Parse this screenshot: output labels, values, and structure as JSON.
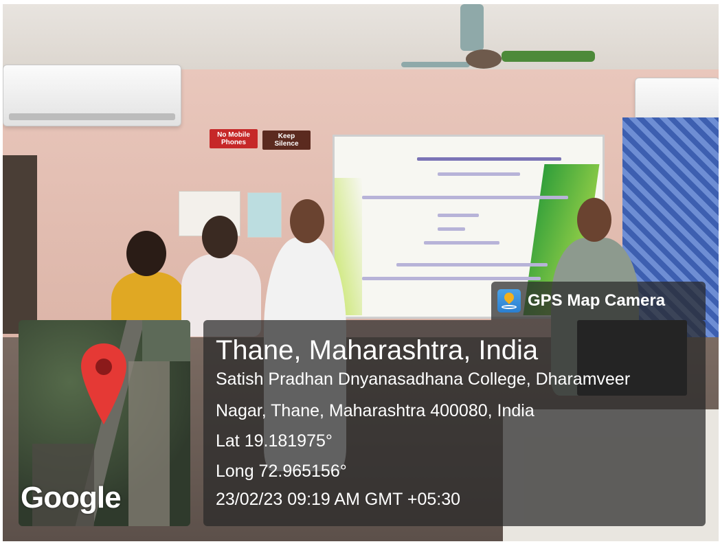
{
  "wall_signs": {
    "no_mobile": "No Mobile Phones",
    "keep_silence": "Keep Silence"
  },
  "app_badge": {
    "icon": "map-pin-icon",
    "title": "GPS Map Camera"
  },
  "location": {
    "city": "Thane, Maharashtra, India",
    "address_line1": "Satish Pradhan Dnyanasadhana College, Dharamveer",
    "address_line2": "Nagar, Thane, Maharashtra 400080, India",
    "latitude": "Lat 19.181975°",
    "longitude": "Long 72.965156°",
    "timestamp": "23/02/23 09:19 AM GMT +05:30"
  },
  "map": {
    "watermark": "Google",
    "marker_icon": "location-marker-icon"
  },
  "colors": {
    "overlay": "#282828",
    "marker": "#e53935",
    "badge_icon_bg": "#2b7fd0"
  }
}
